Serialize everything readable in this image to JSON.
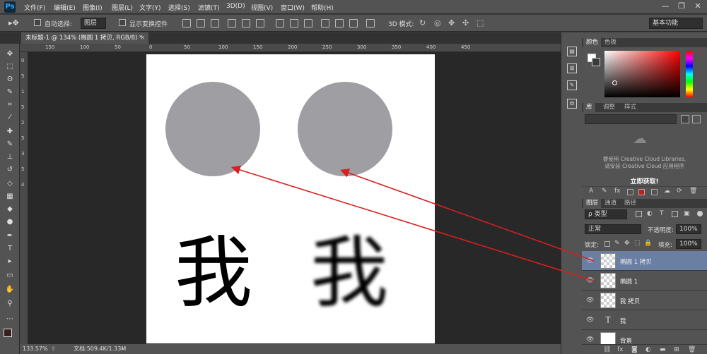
{
  "app": {
    "logo": "Ps"
  },
  "menu": [
    "文件(F)",
    "编辑(E)",
    "图像(I)",
    "图层(L)",
    "文字(Y)",
    "选择(S)",
    "滤镜(T)",
    "3D(D)",
    "视图(V)",
    "窗口(W)",
    "帮助(H)"
  ],
  "window_controls": {
    "minimize": "—",
    "restore": "❐",
    "close": "✕"
  },
  "options": {
    "auto_select_label": "自动选择:",
    "auto_select_value": "图层",
    "show_transform_label": "显示变换控件",
    "mode3d_label": "3D 模式:",
    "workspace": "基本功能"
  },
  "document": {
    "tab_title": "未标题-1 @ 134% (椭圆 1 拷贝, RGB/8) *",
    "tab_close": "×",
    "canvas_text_left": "我",
    "canvas_text_right": "我",
    "circle_color": "#9f9ea3",
    "arrow_color": "#d91f1f"
  },
  "rulers": {
    "h": [
      "150",
      "100",
      "50",
      "0",
      "50",
      "100",
      "150",
      "200",
      "250",
      "300",
      "350",
      "400",
      "450"
    ],
    "v": [
      "0",
      "5",
      "1",
      "5",
      "2",
      "5",
      "3",
      "5",
      "4"
    ]
  },
  "tools": [
    "move-icon",
    "marquee-icon",
    "lasso-icon",
    "quick-select-icon",
    "crop-icon",
    "eyedropper-icon",
    "healing-icon",
    "brush-icon",
    "stamp-icon",
    "history-brush-icon",
    "eraser-icon",
    "gradient-icon",
    "blur-icon",
    "dodge-icon",
    "pen-icon",
    "type-icon",
    "path-select-icon",
    "shape-icon",
    "hand-icon",
    "zoom-icon"
  ],
  "tool_glyphs": [
    "✥",
    "⬚",
    "ʘ",
    "✎",
    "⌗",
    "⁄",
    "✚",
    "✎",
    "⊥",
    "↺",
    "◇",
    "▦",
    "◆",
    "●",
    "✒",
    "T",
    "▸",
    "▭",
    "✋",
    "⚲"
  ],
  "status": {
    "zoom": "133.57%",
    "doc_info": "文档:509.4K/1.33M"
  },
  "color_panel": {
    "tabs": [
      "颜色",
      "色板"
    ],
    "fg": "#ffffff",
    "bg": "#3a3a3a"
  },
  "library_panel": {
    "tabs": [
      "库",
      "调整",
      "样式"
    ],
    "message_line1": "要使用 Creative Cloud Libraries,",
    "message_line2": "请安装 Creative Cloud 应用程序",
    "action": "立即获取!"
  },
  "layers_panel": {
    "tabs": [
      "图层",
      "通道",
      "路径"
    ],
    "filter_label": "ρ 类型",
    "blend_mode": "正常",
    "opacity_label": "不透明度:",
    "opacity": "100%",
    "lock_label": "锁定:",
    "fill_label": "填充:",
    "fill": "100%",
    "layers": [
      {
        "name": "椭圆 1 拷贝",
        "selected": true
      },
      {
        "name": "椭圆 1",
        "selected": false
      },
      {
        "name": "我 拷贝",
        "selected": false
      },
      {
        "name": "我",
        "selected": false
      },
      {
        "name": "背景",
        "selected": false
      }
    ],
    "footer_icons": [
      "link-icon",
      "fx-icon",
      "mask-icon",
      "adjustment-icon",
      "folder-icon",
      "new-layer-icon",
      "trash-icon"
    ]
  }
}
